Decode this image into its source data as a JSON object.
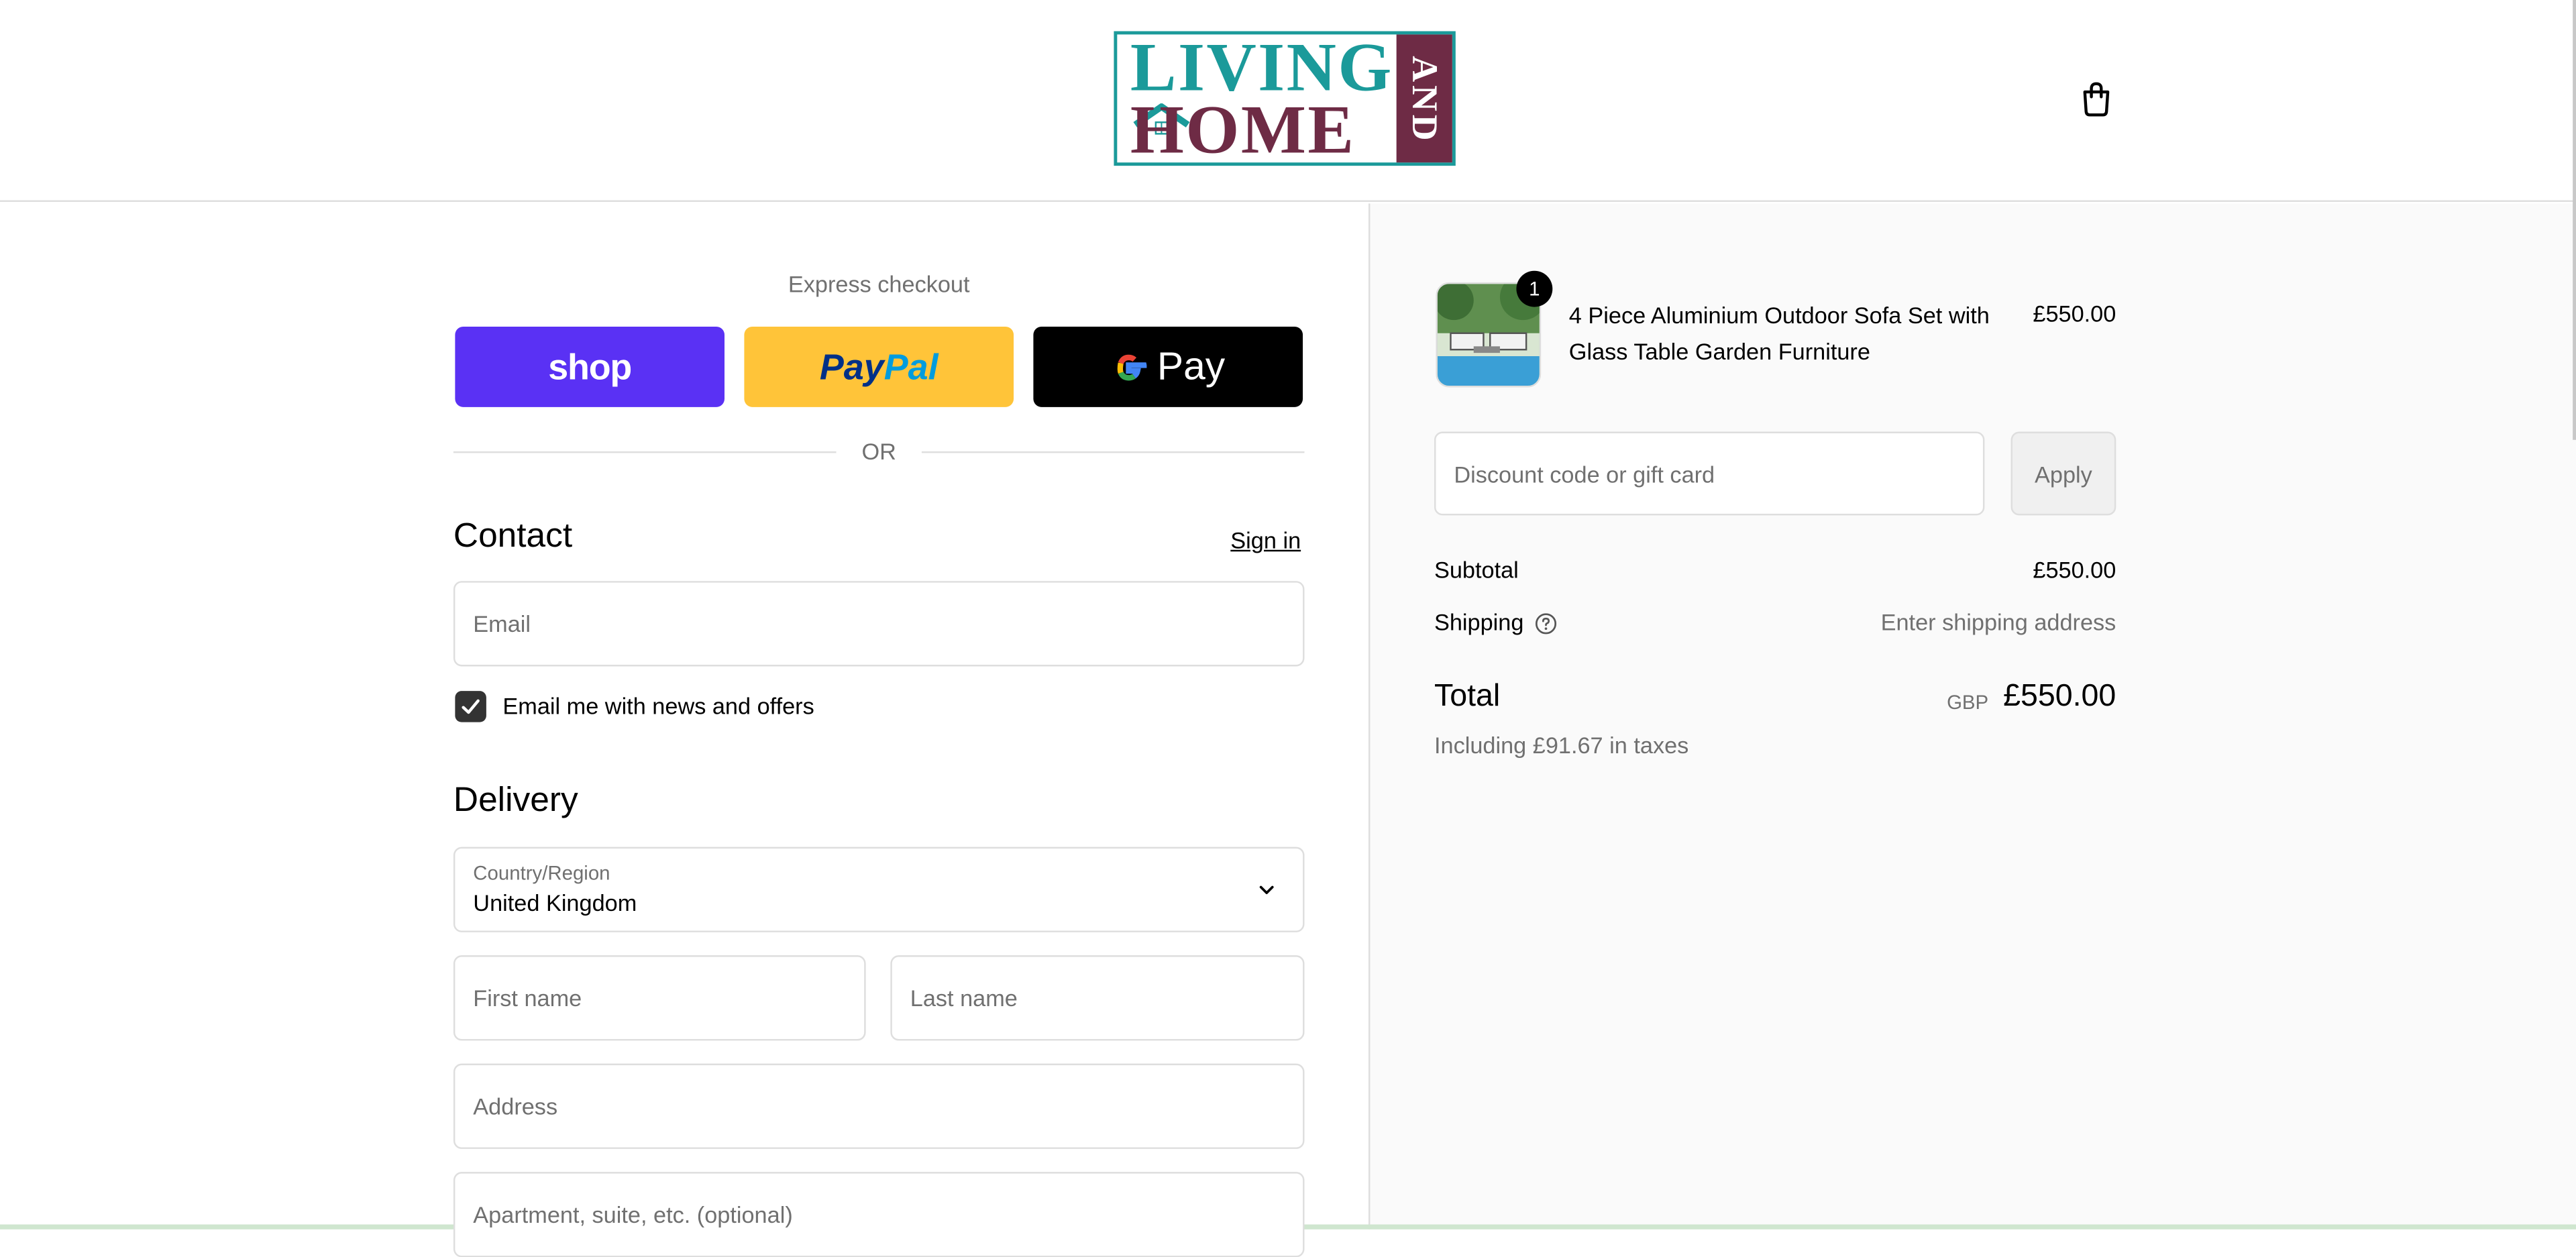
{
  "header": {
    "logo": {
      "line1": "LIVING",
      "line2": "HOME",
      "side": "AND"
    },
    "cart_icon": "shopping-bag-icon"
  },
  "express": {
    "title": "Express checkout",
    "shop_label": "shop",
    "paypal_part1": "Pay",
    "paypal_part2": "Pal",
    "gpay_label": "Pay",
    "or_label": "OR"
  },
  "contact": {
    "title": "Contact",
    "sign_in": "Sign in",
    "email_placeholder": "Email",
    "newsletter_label": "Email me with news and offers",
    "newsletter_checked": true
  },
  "delivery": {
    "title": "Delivery",
    "country_label": "Country/Region",
    "country_value": "United Kingdom",
    "first_name_placeholder": "First name",
    "last_name_placeholder": "Last name",
    "address_placeholder": "Address",
    "apartment_placeholder": "Apartment, suite, etc. (optional)"
  },
  "summary": {
    "item": {
      "quantity": "1",
      "name": "4 Piece Aluminium Outdoor Sofa Set with Glass Table Garden Furniture",
      "price": "£550.00"
    },
    "discount_placeholder": "Discount code or gift card",
    "apply_label": "Apply",
    "subtotal_label": "Subtotal",
    "subtotal_value": "£550.00",
    "shipping_label": "Shipping",
    "shipping_value": "Enter shipping address",
    "total_label": "Total",
    "currency": "GBP",
    "total_value": "£550.00",
    "tax_note": "Including £91.67 in taxes"
  },
  "colors": {
    "shop_purple": "#5a31f4",
    "paypal_yellow": "#ffc439",
    "gpay_black": "#000000",
    "logo_teal": "#1b9a9a",
    "logo_plum": "#6e2b45",
    "panel_bg": "#fafafa"
  }
}
